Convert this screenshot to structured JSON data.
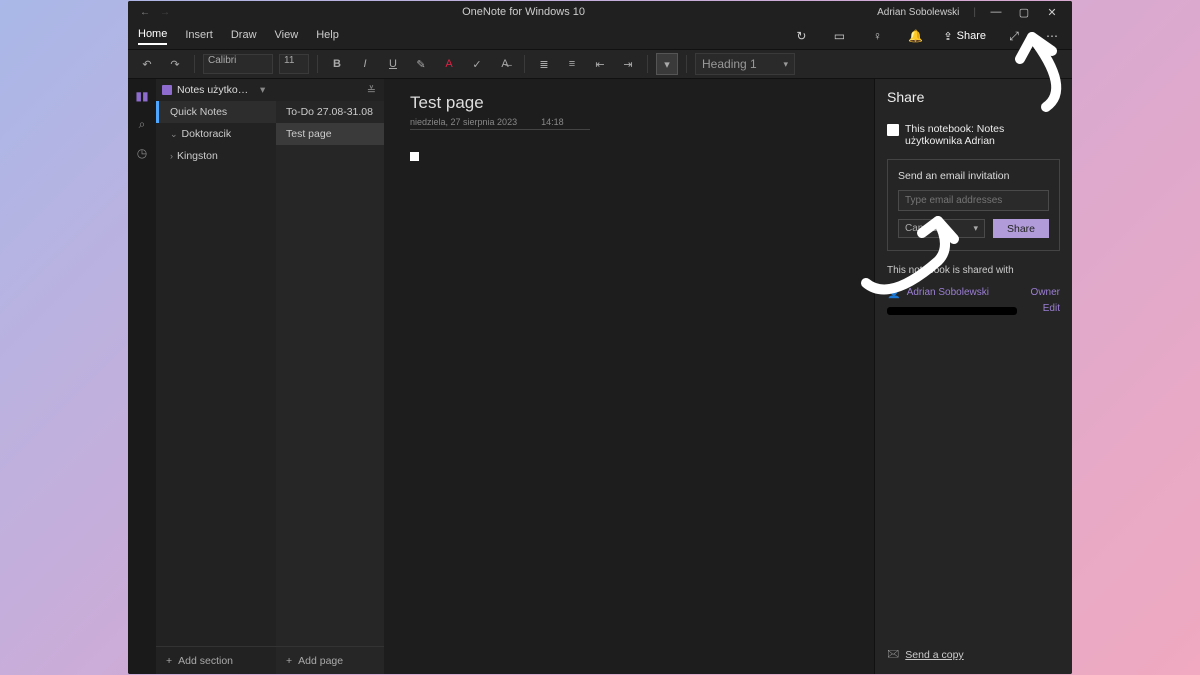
{
  "titlebar": {
    "app_title": "OneNote for Windows 10",
    "user_name": "Adrian Sobolewski"
  },
  "menu": {
    "tabs": [
      "Home",
      "Insert",
      "Draw",
      "View",
      "Help"
    ],
    "active_tab": "Home",
    "share_label": "Share"
  },
  "ribbon": {
    "font_name": "Calibri",
    "font_size": "11",
    "style_label": "Heading 1"
  },
  "notebook": {
    "name": "Notes użytkownika Adrian"
  },
  "sections": {
    "items": [
      {
        "label": "Quick Notes",
        "active": true
      },
      {
        "label": "Doktoracik",
        "expandable": true
      },
      {
        "label": "Kingston",
        "expandable": true
      }
    ],
    "add_label": "Add section"
  },
  "pages": {
    "items": [
      {
        "label": "To-Do 27.08-31.08",
        "selected": false
      },
      {
        "label": "Test page",
        "selected": true
      }
    ],
    "add_label": "Add page"
  },
  "canvas": {
    "title": "Test page",
    "date": "niedziela, 27 sierpnia 2023",
    "time": "14:18"
  },
  "share": {
    "pane_title": "Share",
    "notebook_line": "This notebook: Notes użytkownika Adrian",
    "invite_label": "Send an email invitation",
    "email_placeholder": "Type email addresses",
    "permission": "Can edit",
    "share_button": "Share",
    "shared_with_label": "This notebook is shared with",
    "person_name": "Adrian Sobolewski",
    "person_role": "Owner",
    "edit_label": "Edit",
    "send_copy": "Send a copy"
  }
}
